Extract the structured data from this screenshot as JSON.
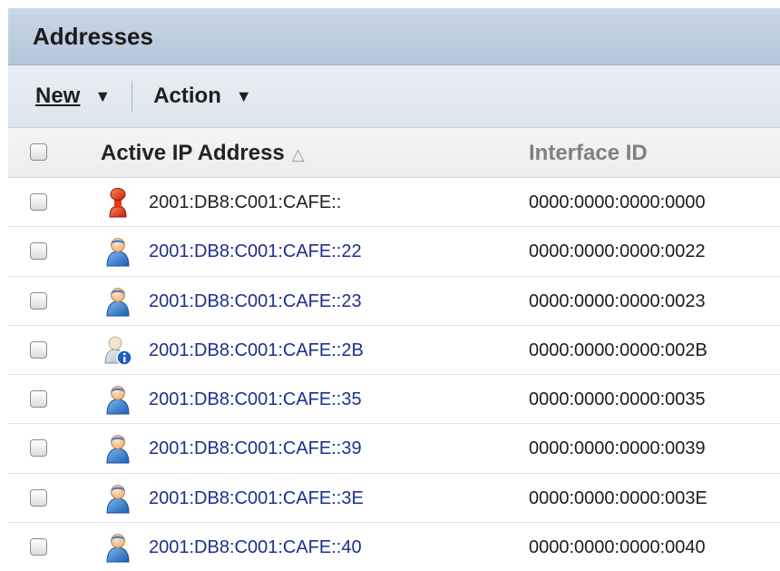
{
  "panel": {
    "title": "Addresses"
  },
  "toolbar": {
    "new_label": "New",
    "action_label": "Action",
    "caret": "▼"
  },
  "table": {
    "columns": [
      {
        "label": "Active IP Address",
        "sort_indicator": "△"
      },
      {
        "label": "Interface ID"
      }
    ],
    "rows": [
      {
        "ip": "2001:DB8:C001:CAFE::",
        "interface_id": "0000:0000:0000:0000",
        "icon": "red-pin-icon",
        "linked": false
      },
      {
        "ip": "2001:DB8:C001:CAFE::22",
        "interface_id": "0000:0000:0000:0022",
        "icon": "blue-user-icon",
        "linked": true
      },
      {
        "ip": "2001:DB8:C001:CAFE::23",
        "interface_id": "0000:0000:0000:0023",
        "icon": "blue-user-icon",
        "linked": true
      },
      {
        "ip": "2001:DB8:C001:CAFE::2B",
        "interface_id": "0000:0000:0000:002B",
        "icon": "user-with-info-badge-icon",
        "linked": true
      },
      {
        "ip": "2001:DB8:C001:CAFE::35",
        "interface_id": "0000:0000:0000:0035",
        "icon": "blue-user-icon",
        "linked": true
      },
      {
        "ip": "2001:DB8:C001:CAFE::39",
        "interface_id": "0000:0000:0000:0039",
        "icon": "blue-user-icon",
        "linked": true
      },
      {
        "ip": "2001:DB8:C001:CAFE::3E",
        "interface_id": "0000:0000:0000:003E",
        "icon": "blue-user-icon",
        "linked": true
      },
      {
        "ip": "2001:DB8:C001:CAFE::40",
        "interface_id": "0000:0000:0000:0040",
        "icon": "blue-user-icon",
        "linked": true
      }
    ]
  },
  "colors": {
    "link": "#1f2f8c",
    "header_bar": "#bdcde0",
    "toolbar_bg": "#e4e9ef"
  }
}
